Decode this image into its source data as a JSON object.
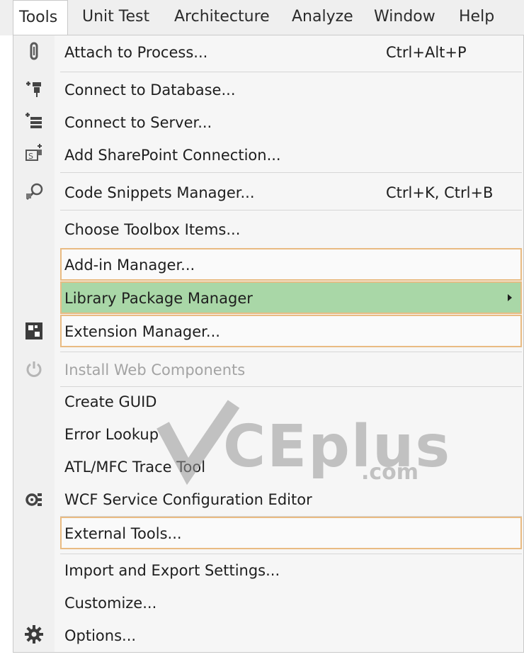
{
  "menubar": {
    "items": [
      "Tools",
      "Unit Test",
      "Architecture",
      "Analyze",
      "Window",
      "Help"
    ]
  },
  "menu": {
    "items": [
      {
        "label": "Attach to Process...",
        "shortcut": "Ctrl+Alt+P",
        "icon": "attach-icon"
      },
      {
        "label": "Connect to Database...",
        "icon": "database-plug-icon"
      },
      {
        "label": "Connect to Server...",
        "icon": "server-plus-icon"
      },
      {
        "label": "Add SharePoint Connection...",
        "icon": "sharepoint-icon"
      },
      {
        "label": "Code Snippets Manager...",
        "shortcut": "Ctrl+K, Ctrl+B",
        "icon": "snippets-icon"
      },
      {
        "label": "Choose Toolbox Items..."
      },
      {
        "label": "Add-in Manager..."
      },
      {
        "label": "Library Package Manager",
        "has_submenu": true
      },
      {
        "label": "Extension Manager...",
        "icon": "extension-icon"
      },
      {
        "label": "Install Web Components",
        "disabled": true,
        "icon": "power-icon"
      },
      {
        "label": "Create GUID"
      },
      {
        "label": "Error Lookup"
      },
      {
        "label": "ATL/MFC Trace Tool"
      },
      {
        "label": "WCF Service Configuration Editor",
        "icon": "wcf-config-icon"
      },
      {
        "label": "External Tools..."
      },
      {
        "label": "Import and Export Settings..."
      },
      {
        "label": "Customize..."
      },
      {
        "label": "Options...",
        "icon": "gear-icon"
      }
    ]
  },
  "watermark": {
    "text": "CEplus",
    "suffix": ".com"
  },
  "colors": {
    "highlight": "#a9d7a7",
    "annotation_box": "#e9bb82"
  }
}
